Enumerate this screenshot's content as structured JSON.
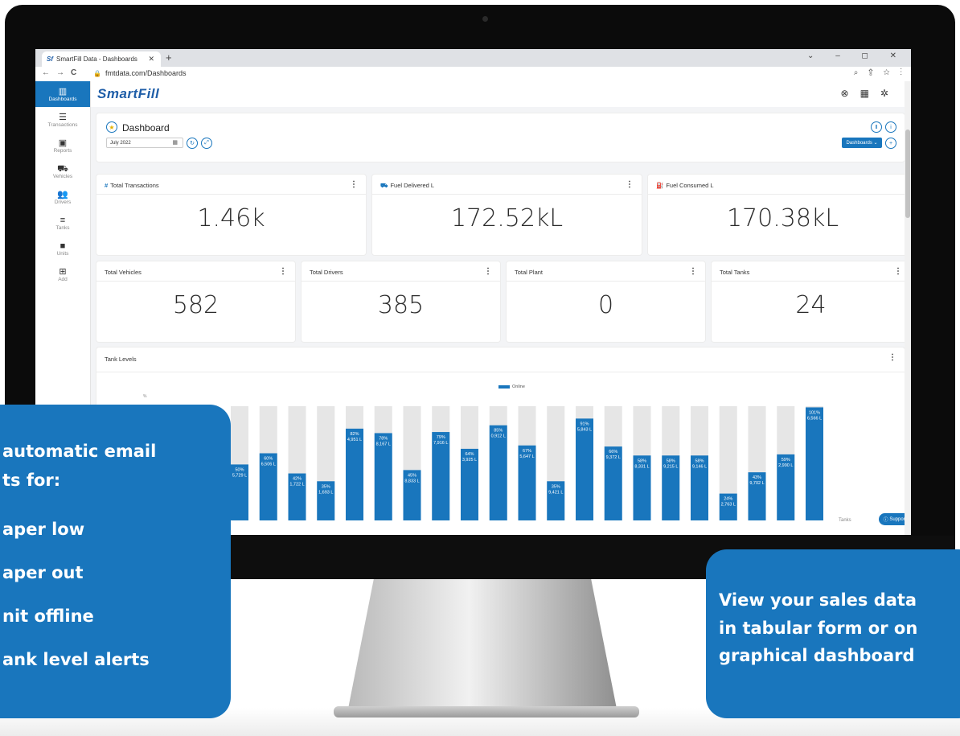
{
  "browser": {
    "tab_title": "SmartFill Data - Dashboards",
    "favicon_label": "Sf",
    "url": "fmtdata.com/Dashboards"
  },
  "leftnav": [
    {
      "label": "Dashboards",
      "icon": "bar-chart-icon",
      "active": true
    },
    {
      "label": "Transactions",
      "icon": "list-icon",
      "active": false
    },
    {
      "label": "Reports",
      "icon": "clipboard-icon",
      "active": false
    },
    {
      "label": "Vehicles",
      "icon": "car-icon",
      "active": false
    },
    {
      "label": "Drivers",
      "icon": "users-icon",
      "active": false
    },
    {
      "label": "Tanks",
      "icon": "stack-icon",
      "active": false
    },
    {
      "label": "Units",
      "icon": "square-icon",
      "active": false
    },
    {
      "label": "Add",
      "icon": "plus-icon",
      "active": false
    }
  ],
  "brand": "SmartFill",
  "dashboard": {
    "title": "Dashboard",
    "date_value": "July 2022",
    "dashboards_button": "Dashboards"
  },
  "stats_row1": [
    {
      "label": "Total Transactions",
      "value": "1.46k",
      "icon": "hash-icon"
    },
    {
      "label": "Fuel Delivered L",
      "value": "172.52kL",
      "icon": "truck-icon"
    },
    {
      "label": "Fuel Consumed L",
      "value": "170.38kL",
      "icon": "fuel-pump-icon"
    }
  ],
  "stats_row2": [
    {
      "label": "Total Vehicles",
      "value": "582"
    },
    {
      "label": "Total Drivers",
      "value": "385"
    },
    {
      "label": "Total Plant",
      "value": "0"
    },
    {
      "label": "Total Tanks",
      "value": "24"
    }
  ],
  "chart_title": "Tank Levels",
  "chart_data": {
    "type": "bar",
    "legend": [
      "Online"
    ],
    "ylabel": "%",
    "xlabel": "Tanks",
    "ylim": [
      0,
      100
    ],
    "accent_color": "#1976bd",
    "background_color": "#e6e6e6",
    "percents": [
      50,
      60,
      42,
      35,
      82,
      78,
      45,
      79,
      64,
      85,
      67,
      35,
      91,
      66,
      58,
      58,
      58,
      24,
      43,
      59,
      101
    ],
    "litres": [
      "5,729 L",
      "6,506 L",
      "1,722 L",
      "1,693 L",
      "4,951 L",
      "8,167 L",
      "8,833 L",
      "7,916 L",
      "3,925 L",
      "0,912 L",
      "5,647 L",
      "9,421 L",
      "5,843 L",
      "9,372 L",
      "8,331 L",
      "9,215 L",
      "9,146 L",
      "2,763 L",
      "9,702 L",
      "2,990 L",
      "6,566 L"
    ]
  },
  "support_button": "Support",
  "callout_left": {
    "lines": [
      "automatic email",
      "ts for:",
      "aper low",
      "aper out",
      "nit offline",
      "ank level alerts"
    ]
  },
  "callout_right": {
    "lines": [
      "View your sales data",
      "in tabular form or on",
      "graphical dashboard"
    ]
  }
}
